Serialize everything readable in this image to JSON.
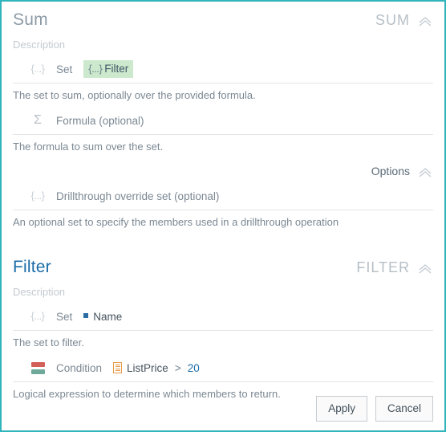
{
  "theme": {
    "border_color": "#2fb5bb",
    "chip_bg": "#cce9cd",
    "accent_blue": "#1b6ca8",
    "muted_gray": "#7b8893",
    "label_gray": "#c3cad0",
    "condition_true_color": "#6fa999",
    "condition_false_color": "#d4605a",
    "measure_orange": "#e79a49",
    "member_blue": "#2b6ca3"
  },
  "sections": [
    {
      "title": "Sum",
      "tag": "SUM",
      "collapse_icon": "chevron-up-icon",
      "description_label": "Description",
      "args": [
        {
          "icon": "braces-set-icon",
          "name": "Set",
          "value_chip": "Filter",
          "value_chip_icon": "braces-set-icon",
          "help": "The set to sum, optionally over the provided formula."
        },
        {
          "icon": "sigma-icon",
          "name": "Formula (optional)",
          "help": "The formula to sum over the set."
        }
      ],
      "options": {
        "label": "Options",
        "collapse_icon": "chevron-up-icon",
        "args": [
          {
            "icon": "braces-set-icon",
            "name": "Drillthrough override set (optional)",
            "help": "An optional set to specify the members used in a drillthrough operation"
          }
        ]
      }
    },
    {
      "title": "Filter",
      "tag": "FILTER",
      "collapse_icon": "chevron-up-icon",
      "description_label": "Description",
      "args": [
        {
          "icon": "braces-set-icon",
          "name": "Set",
          "value_token_icon": "member-square-icon",
          "value_token": "Name",
          "help": "The set to filter."
        },
        {
          "icon": "condition-boolean-icon",
          "name": "Condition",
          "expression": {
            "operand_icon": "measure-column-icon",
            "operand": "ListPrice",
            "operator": ">",
            "literal": "20"
          },
          "help": "Logical expression to determine which members to return."
        }
      ]
    }
  ],
  "footer": {
    "apply_label": "Apply",
    "cancel_label": "Cancel"
  }
}
